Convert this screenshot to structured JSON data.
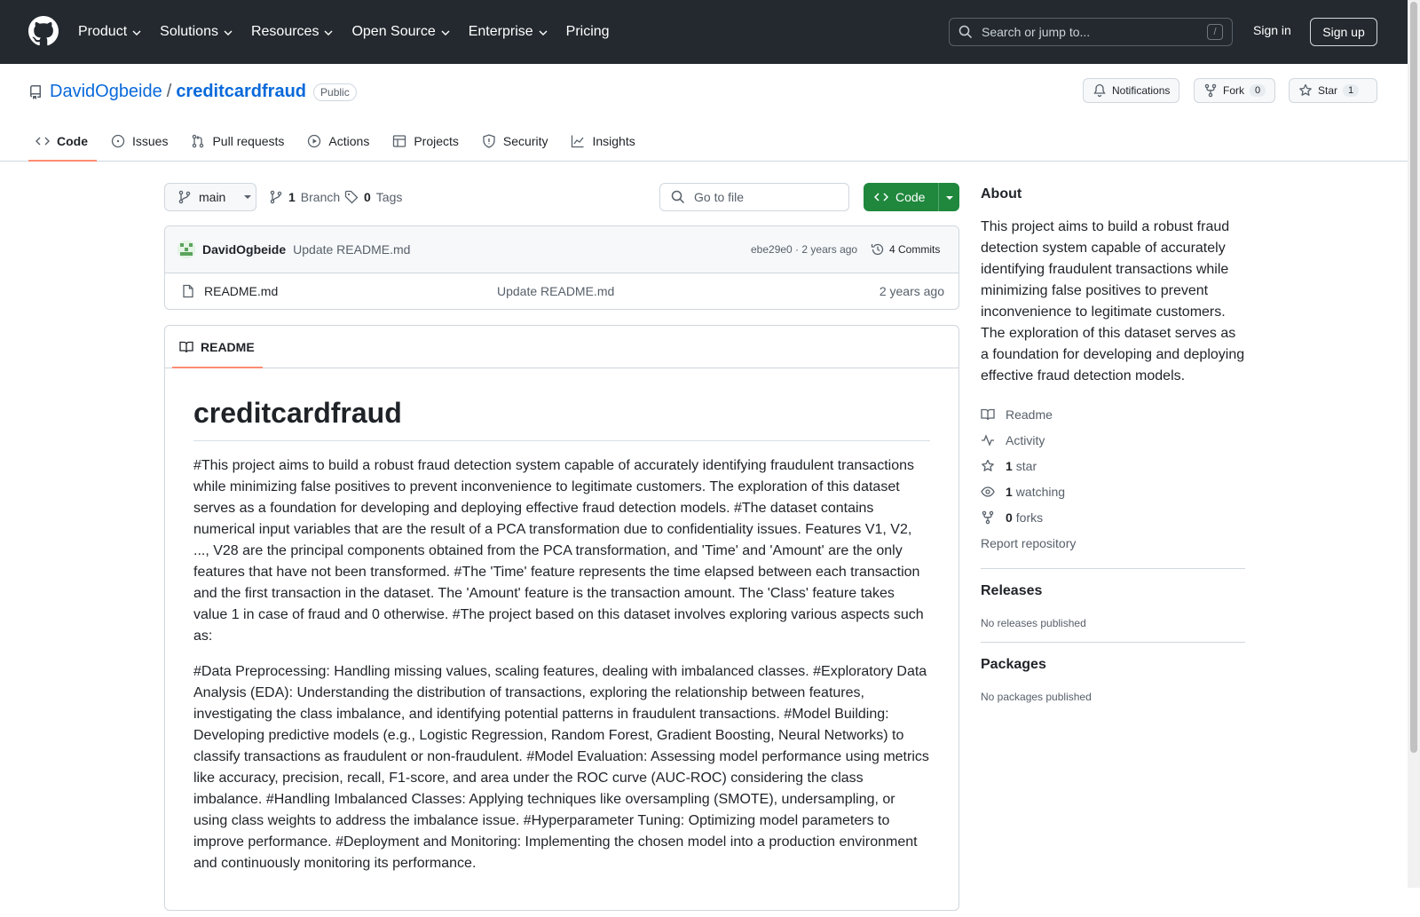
{
  "header": {
    "nav": [
      {
        "label": "Product",
        "has_dropdown": true
      },
      {
        "label": "Solutions",
        "has_dropdown": true
      },
      {
        "label": "Resources",
        "has_dropdown": true
      },
      {
        "label": "Open Source",
        "has_dropdown": true
      },
      {
        "label": "Enterprise",
        "has_dropdown": true
      },
      {
        "label": "Pricing",
        "has_dropdown": false
      }
    ],
    "search_placeholder": "Search or jump to...",
    "search_shortcut": "/",
    "signin_label": "Sign in",
    "signup_label": "Sign up"
  },
  "repo": {
    "owner": "DavidOgbeide",
    "separator": "/",
    "name": "creditcardfraud",
    "visibility": "Public",
    "notifications_label": "Notifications",
    "fork_label": "Fork",
    "fork_count": "0",
    "star_label": "Star",
    "star_count": "1"
  },
  "tabs": [
    {
      "label": "Code",
      "icon": "code-icon",
      "active": true
    },
    {
      "label": "Issues",
      "icon": "issue-icon"
    },
    {
      "label": "Pull requests",
      "icon": "pull-request-icon"
    },
    {
      "label": "Actions",
      "icon": "play-icon"
    },
    {
      "label": "Projects",
      "icon": "table-icon"
    },
    {
      "label": "Security",
      "icon": "shield-icon"
    },
    {
      "label": "Insights",
      "icon": "graph-icon"
    }
  ],
  "branch": {
    "current": "main",
    "branch_count": "1",
    "branch_label": "Branch",
    "tag_count": "0",
    "tag_label": "Tags"
  },
  "gofile_placeholder": "Go to file",
  "code_button_label": "Code",
  "latest_commit": {
    "author": "DavidOgbeide",
    "message": "Update README.md",
    "hash_time": "ebe29e0 · 2 years ago",
    "commits_label": "4 Commits"
  },
  "files": [
    {
      "name": "README.md",
      "message": "Update README.md",
      "time": "2 years ago"
    }
  ],
  "readme": {
    "tab_label": "README",
    "title": "creditcardfraud",
    "paragraphs": [
      "#This project aims to build a robust fraud detection system capable of accurately identifying fraudulent transactions while minimizing false positives to prevent inconvenience to legitimate customers. The exploration of this dataset serves as a foundation for developing and deploying effective fraud detection models. #The dataset contains numerical input variables that are the result of a PCA transformation due to confidentiality issues. Features V1, V2, ..., V28 are the principal components obtained from the PCA transformation, and 'Time' and 'Amount' are the only features that have not been transformed. #The 'Time' feature represents the time elapsed between each transaction and the first transaction in the dataset. The 'Amount' feature is the transaction amount. The 'Class' feature takes value 1 in case of fraud and 0 otherwise. #The project based on this dataset involves exploring various aspects such as:",
      "#Data Preprocessing: Handling missing values, scaling features, dealing with imbalanced classes. #Exploratory Data Analysis (EDA): Understanding the distribution of transactions, exploring the relationship between features, investigating the class imbalance, and identifying potential patterns in fraudulent transactions. #Model Building: Developing predictive models (e.g., Logistic Regression, Random Forest, Gradient Boosting, Neural Networks) to classify transactions as fraudulent or non-fraudulent. #Model Evaluation: Assessing model performance using metrics like accuracy, precision, recall, F1-score, and area under the ROC curve (AUC-ROC) considering the class imbalance. #Handling Imbalanced Classes: Applying techniques like oversampling (SMOTE), undersampling, or using class weights to address the imbalance issue. #Hyperparameter Tuning: Optimizing model parameters to improve performance. #Deployment and Monitoring: Implementing the chosen model into a production environment and continuously monitoring its performance."
    ]
  },
  "about": {
    "heading": "About",
    "description": "This project aims to build a robust fraud detection system capable of accurately identifying fraudulent transactions while minimizing false positives to prevent inconvenience to legitimate customers. The exploration of this dataset serves as a foundation for developing and deploying effective fraud detection models.",
    "readme_label": "Readme",
    "activity_label": "Activity",
    "stars_count": "1",
    "stars_label": "star",
    "watching_count": "1",
    "watching_label": "watching",
    "forks_count": "0",
    "forks_label": "forks",
    "report_label": "Report repository"
  },
  "releases": {
    "heading": "Releases",
    "empty": "No releases published"
  },
  "packages": {
    "heading": "Packages",
    "empty": "No packages published"
  },
  "colors": {
    "header_bg": "#24292f",
    "link": "#0969da",
    "code_button": "#1f883d",
    "active_tab_underline": "#fd8c73"
  }
}
